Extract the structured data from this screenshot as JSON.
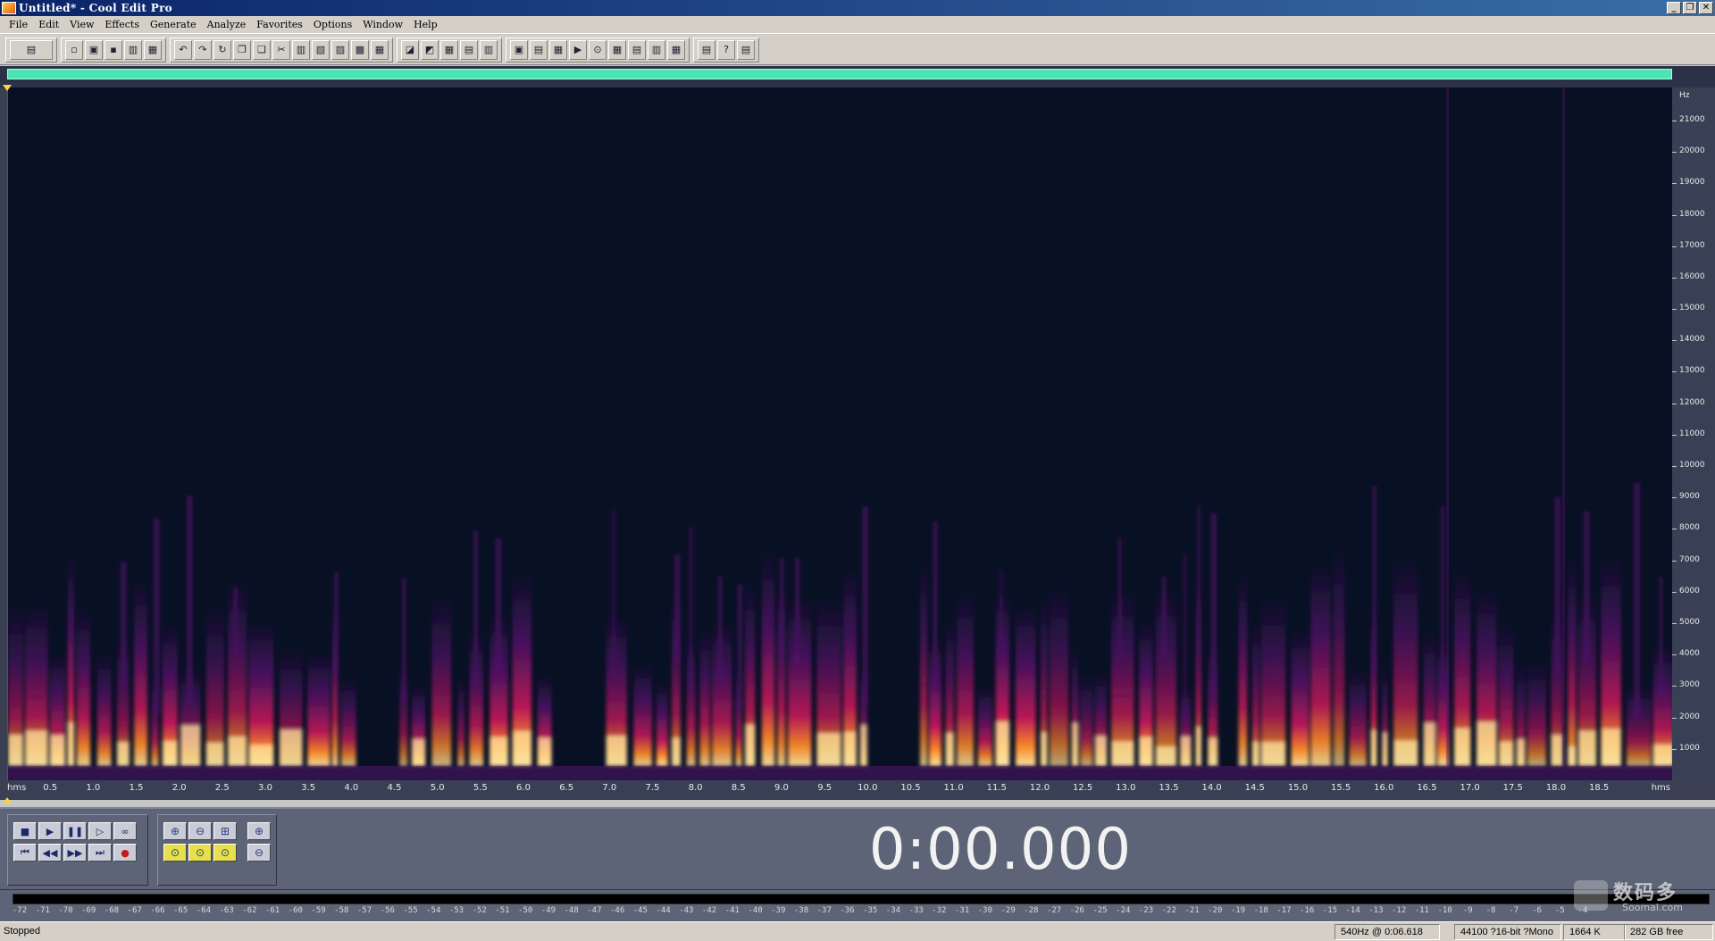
{
  "window": {
    "title": "Untitled* - Cool Edit Pro",
    "minimize": "_",
    "maximize": "❐",
    "close": "✕"
  },
  "menu": [
    "File",
    "Edit",
    "View",
    "Effects",
    "Generate",
    "Analyze",
    "Favorites",
    "Options",
    "Window",
    "Help"
  ],
  "toolbar": {
    "groups": [
      [
        "wave-view-icon"
      ],
      [
        "new-file-icon",
        "open-file-icon",
        "save-icon",
        "save-as-icon",
        "close-file-icon"
      ],
      [
        "undo-icon",
        "redo-icon",
        "repeat-icon",
        "copy-icon",
        "copy-to-new-icon",
        "cut-icon",
        "paste-icon",
        "paste-new-icon",
        "mix-paste-icon",
        "insert-icon",
        "insert-mix-icon"
      ],
      [
        "envelope-icon",
        "marker-icon",
        "grid-icon",
        "grid-alt-icon",
        "snap-icon"
      ],
      [
        "cue-list-icon",
        "play-list-icon",
        "info-icon",
        "play-icon",
        "frequency-icon",
        "sample-rate-icon",
        "batch-icon",
        "spectral-view-icon",
        "waveform-view-icon"
      ],
      [
        "settings-icon",
        "edit-tool-icon",
        "help-icon"
      ]
    ]
  },
  "spectral": {
    "frequency_axis": {
      "unit": "Hz",
      "labels": [
        "21000",
        "20000",
        "19000",
        "18000",
        "17000",
        "16000",
        "15000",
        "14000",
        "13000",
        "12000",
        "11000",
        "10000",
        "9000",
        "8000",
        "7000",
        "6000",
        "5000",
        "4000",
        "3000",
        "2000",
        "1000"
      ]
    },
    "time_axis": {
      "left_unit": "hms",
      "right_unit": "hms",
      "labels": [
        "0.5",
        "1.0",
        "1.5",
        "2.0",
        "2.5",
        "3.0",
        "3.5",
        "4.0",
        "4.5",
        "5.0",
        "5.5",
        "6.0",
        "6.5",
        "7.0",
        "7.5",
        "8.0",
        "8.5",
        "9.0",
        "9.5",
        "10.0",
        "10.5",
        "11.0",
        "11.5",
        "12.0",
        "12.5",
        "13.0",
        "13.5",
        "14.0",
        "14.5",
        "15.0",
        "15.5",
        "16.0",
        "16.5",
        "17.0",
        "17.5",
        "18.0",
        "18.5"
      ]
    },
    "colors": {
      "background": "#081024",
      "low": "#5a1470",
      "mid": "#c8185a",
      "high": "#ff8c28",
      "peak": "#ffe6a0"
    }
  },
  "transport": {
    "stop": "■",
    "play": "▶",
    "pause": "❚❚",
    "play_to_end": "▷",
    "loop": "∞",
    "go_start": "⏮",
    "rewind": "◀◀",
    "fast_forward": "▶▶",
    "go_end": "⏭",
    "record": "●"
  },
  "zoom": {
    "zoom_in_h": "⊕",
    "zoom_out_h": "⊖",
    "zoom_full": "⊞",
    "zoom_in_v": "⊕",
    "zoom_left": "⊙",
    "zoom_right": "⊙",
    "zoom_sel": "⊙",
    "zoom_out_v": "⊖"
  },
  "time_display": "0:00.000",
  "meter": {
    "labels": [
      "-72",
      "-71",
      "-70",
      "-69",
      "-68",
      "-67",
      "-66",
      "-65",
      "-64",
      "-63",
      "-62",
      "-61",
      "-60",
      "-59",
      "-58",
      "-57",
      "-56",
      "-55",
      "-54",
      "-53",
      "-52",
      "-51",
      "-50",
      "-49",
      "-48",
      "-47",
      "-46",
      "-45",
      "-44",
      "-43",
      "-42",
      "-41",
      "-40",
      "-39",
      "-38",
      "-37",
      "-36",
      "-35",
      "-34",
      "-33",
      "-32",
      "-31",
      "-30",
      "-29",
      "-28",
      "-27",
      "-26",
      "-25",
      "-24",
      "-23",
      "-22",
      "-21",
      "-20",
      "-19",
      "-18",
      "-17",
      "-16",
      "-15",
      "-14",
      "-13",
      "-12",
      "-11",
      "-10",
      "-9",
      "-8",
      "-7",
      "-6",
      "-5",
      "-4"
    ]
  },
  "watermark": {
    "cn": "数码多",
    "en": "Soomal.com"
  },
  "status": {
    "state": "Stopped",
    "cursor": "540Hz @  0:06.618",
    "format": "44100 ?16-bit ?Mono",
    "size": "1664 K",
    "free": "282 GB free"
  }
}
